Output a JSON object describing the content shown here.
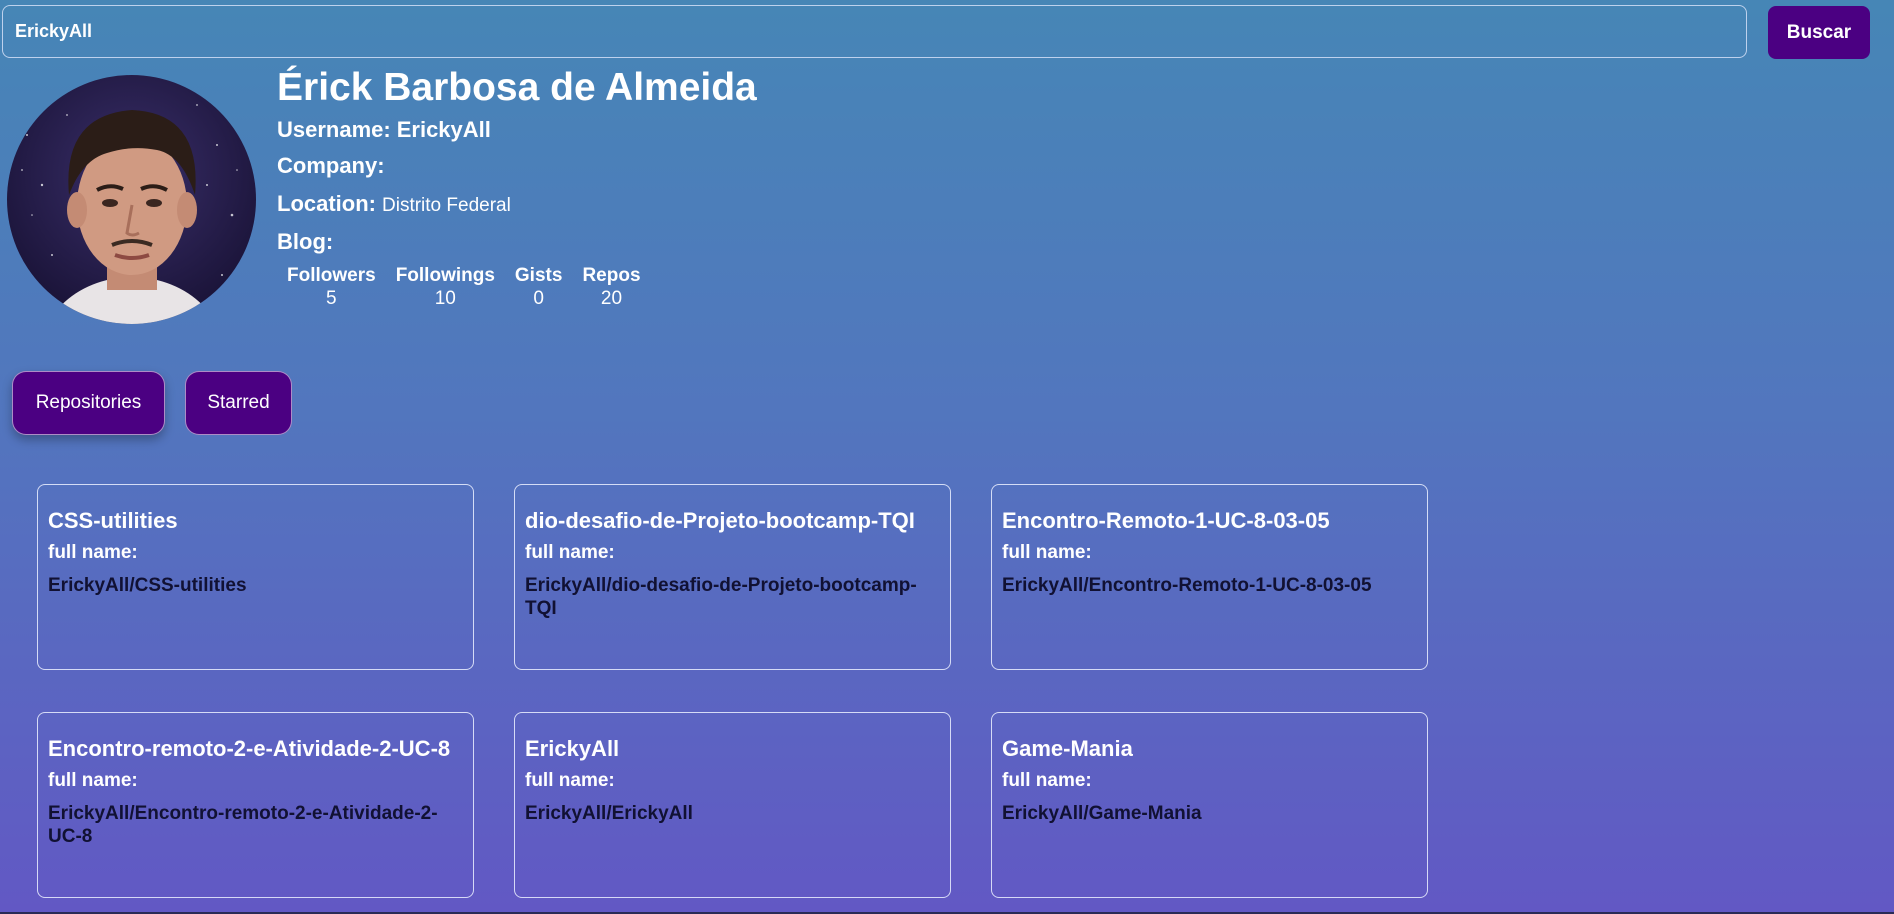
{
  "search": {
    "value": "ErickyAll",
    "placeholder": "",
    "button_label": "Buscar"
  },
  "profile": {
    "name": "Érick Barbosa de Almeida",
    "username_label": "Username:",
    "username": "ErickyAll",
    "company_label": "Company:",
    "company": "",
    "location_label": "Location:",
    "location": "Distrito Federal",
    "blog_label": "Blog:",
    "blog": ""
  },
  "stats": [
    {
      "label": "Followers",
      "value": "5"
    },
    {
      "label": "Followings",
      "value": "10"
    },
    {
      "label": "Gists",
      "value": "0"
    },
    {
      "label": "Repos",
      "value": "20"
    }
  ],
  "tabs": {
    "repositories": "Repositories",
    "starred": "Starred"
  },
  "repos": [
    {
      "name": "CSS-utilities",
      "full_name_label": "full name:",
      "full_name": "ErickyAll/CSS-utilities"
    },
    {
      "name": "dio-desafio-de-Projeto-bootcamp-TQI",
      "full_name_label": "full name:",
      "full_name": "ErickyAll/dio-desafio-de-Projeto-bootcamp-TQI"
    },
    {
      "name": "Encontro-Remoto-1-UC-8-03-05",
      "full_name_label": "full name:",
      "full_name": "ErickyAll/Encontro-Remoto-1-UC-8-03-05"
    },
    {
      "name": "Encontro-remoto-2-e-Atividade-2-UC-8",
      "full_name_label": "full name:",
      "full_name": "ErickyAll/Encontro-remoto-2-e-Atividade-2-UC-8"
    },
    {
      "name": "ErickyAll",
      "full_name_label": "full name:",
      "full_name": "ErickyAll/ErickyAll"
    },
    {
      "name": "Game-Mania",
      "full_name_label": "full name:",
      "full_name": "ErickyAll/Game-Mania"
    }
  ],
  "colors": {
    "button_bg": "#4b0082",
    "gradient_top": "#4686b6",
    "gradient_bottom": "#6258c4"
  }
}
